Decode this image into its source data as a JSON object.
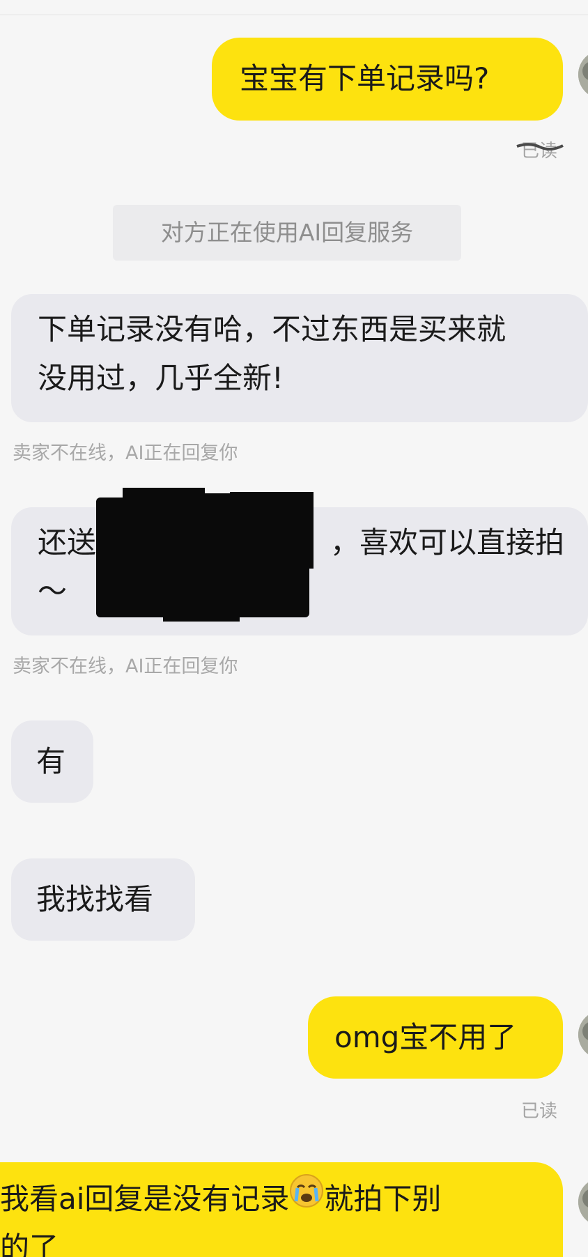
{
  "messages": [
    {
      "side": "outgoing",
      "text": "宝宝有下单记录吗?",
      "read": "已读"
    },
    {
      "side": "notice",
      "text": "对方正在使用AI回复服务"
    },
    {
      "side": "incoming",
      "lines": [
        "下单记录没有哈，不过东西是买来就",
        "没用过，几乎全新!"
      ],
      "status": "卖家不在线，AI正在回复你"
    },
    {
      "side": "incoming",
      "lines": [
        "还送",
        "，喜欢可以直接拍",
        "～"
      ],
      "status": "卖家不在线，AI正在回复你"
    },
    {
      "side": "incoming",
      "text": "有"
    },
    {
      "side": "incoming",
      "text": "我找找看"
    },
    {
      "side": "outgoing",
      "text": "omg宝不用了",
      "read": "已读"
    },
    {
      "side": "outgoing",
      "text_before_emoji": "我看ai回复是没有记录",
      "emoji": "crying-face",
      "text_after_emoji": "就拍下别",
      "line2": "的了"
    }
  ],
  "colors": {
    "outgoing_bubble": "#fde20f",
    "incoming_bubble": "#e9e9ee",
    "background": "#f6f6f6",
    "muted_text": "#a8a8a8"
  }
}
